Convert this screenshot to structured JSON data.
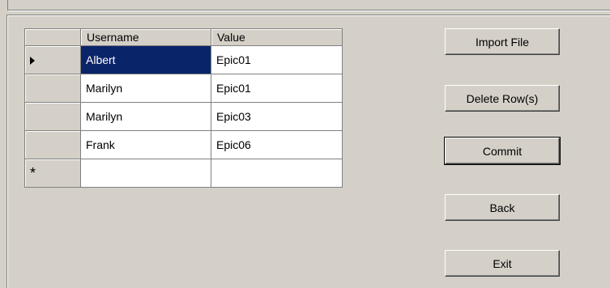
{
  "grid": {
    "columns": [
      "Username",
      "Value"
    ],
    "rows": [
      {
        "username": "Albert",
        "value": "Epic01"
      },
      {
        "username": "Marilyn",
        "value": "Epic01"
      },
      {
        "username": "Marilyn",
        "value": "Epic03"
      },
      {
        "username": "Frank",
        "value": "Epic06"
      }
    ],
    "new_row_marker": "*",
    "current_row_indicator": "triangle-right-icon"
  },
  "buttons": {
    "import_file": "Import File",
    "delete_rows": "Delete Row(s)",
    "commit": "Commit",
    "back": "Back",
    "exit": "Exit"
  },
  "colors": {
    "selection": "#0a246a",
    "face": "#d4d0c8"
  }
}
